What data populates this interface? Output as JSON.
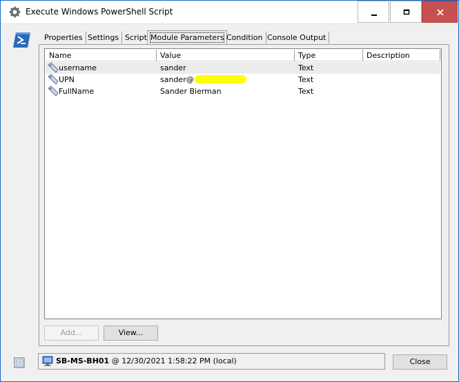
{
  "window": {
    "title": "Execute Windows PowerShell Script"
  },
  "tabs": [
    {
      "label": "Properties"
    },
    {
      "label": "Settings"
    },
    {
      "label": "Script"
    },
    {
      "label": "Module Parameters",
      "active": true
    },
    {
      "label": "Condition"
    },
    {
      "label": "Console Output"
    }
  ],
  "table": {
    "columns": [
      "Name",
      "Value",
      "Type",
      "Description"
    ],
    "rows": [
      {
        "name": "username",
        "value": "sander",
        "type": "Text",
        "description": ""
      },
      {
        "name": "UPN",
        "value": "sander@",
        "type": "Text",
        "description": ""
      },
      {
        "name": "FullName",
        "value": "Sander Bierman",
        "type": "Text",
        "description": ""
      }
    ]
  },
  "buttons": {
    "add": "Add...",
    "view": "View...",
    "close": "Close"
  },
  "status": {
    "computer": "SB-MS-BH01",
    "at": "@ 12/30/2021 1:58:22 PM (local)"
  },
  "colors": {
    "accent": "#1a6fd0",
    "close_button": "#c75050",
    "redaction": "#ffff00"
  },
  "icons": [
    "gear-icon",
    "powershell-icon",
    "parameter-icon",
    "computer-icon",
    "properties-icon"
  ]
}
